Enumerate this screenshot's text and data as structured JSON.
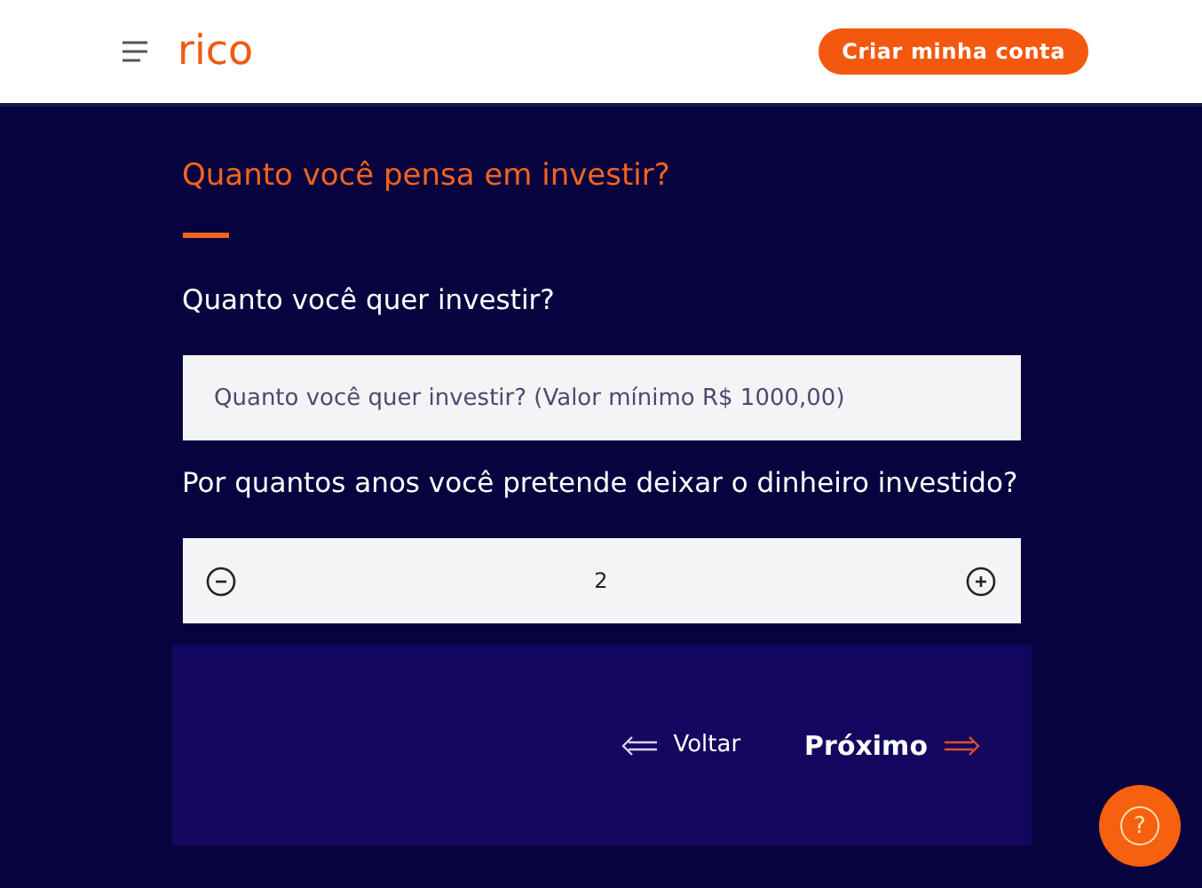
{
  "header": {
    "logo": "rico",
    "cta_button": "Criar minha conta"
  },
  "form": {
    "title": "Quanto você pensa em investir?",
    "amount_question": "Quanto você quer investir?",
    "amount_field": {
      "placeholder": "Quanto você quer investir? (Valor mínimo R$ 1000,00)"
    },
    "years_question": "Por quantos anos você pretende deixar o dinheiro investido?",
    "years_stepper": {
      "value": "2"
    }
  },
  "navigation": {
    "back_button": "Voltar",
    "next_button": "Próximo"
  },
  "help_button": {
    "label": "?"
  }
}
